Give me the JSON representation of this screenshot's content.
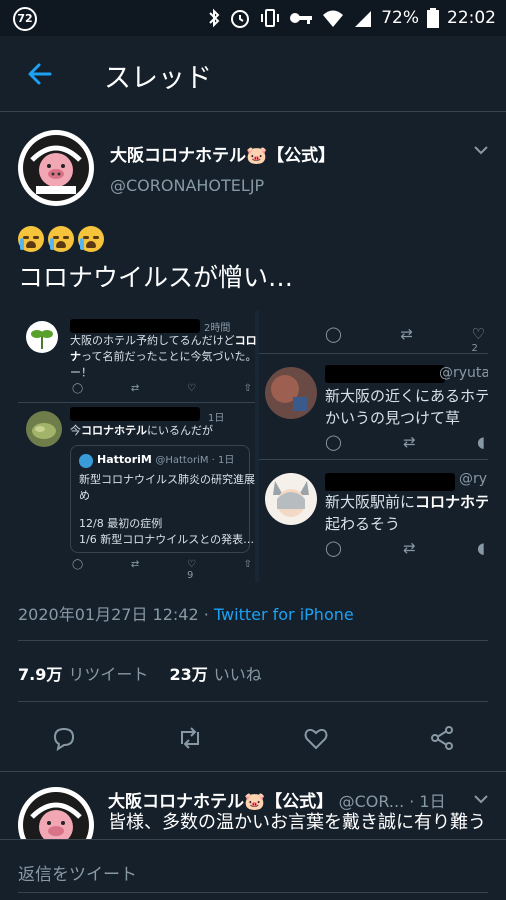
{
  "status_bar": {
    "notification_count": "72",
    "battery": "72%",
    "time": "22:02"
  },
  "header": {
    "title": "スレッド"
  },
  "main_tweet": {
    "name": "大阪コロナホテル🐷【公式】",
    "handle": "@CORONAHOTELJP",
    "text": "コロナウイルスが憎い…",
    "timestamp": "2020年01月27日 12:42 · ",
    "source": "Twitter for iPhone",
    "retweets_count": "7.9万",
    "retweets_label": "リツイート",
    "likes_count": "23万",
    "likes_label": "いいね"
  },
  "screenshot": {
    "tweet1": {
      "time": "2時間",
      "line1": "大阪のホテル予約してるんだけど",
      "line1_bold": "コロ",
      "line2_bold": "ナ",
      "line2": "って名前だったことに今気づいた。",
      "line3": "ー！"
    },
    "tweet2": {
      "time": "1日",
      "text_pre": "今",
      "text_bold": "コロナホテル",
      "text_post": "にいるんだが"
    },
    "quote": {
      "name": "HattoriM",
      "handle": "@HattoriM · 1日",
      "line1": "新型コロナウイルス肺炎の研究進展",
      "line2": "め",
      "line3": "12/8 最初の症例",
      "line4": "1/6 新型コロナウイルスとの発表…"
    },
    "like_count_quote": "9",
    "right_like_count": "2",
    "right_tweet1": {
      "handle": "@ryutaro_",
      "line1": "新大阪の近くにあるホテ",
      "line2": "かいうの見つけて草"
    },
    "right_tweet2": {
      "handle": "@ry",
      "line1_pre": "新大阪駅前に",
      "line1_bold": "コロナホテ",
      "line2": "起わるそう"
    }
  },
  "reply_tweet": {
    "name": "大阪コロナホテル🐷【公式】",
    "handle": "@COR... · 1日",
    "text": "皆様、多数の温かいお言葉を戴き誠に有り難う"
  },
  "reply_bar": {
    "placeholder": "返信をツイート"
  },
  "colors": {
    "background": "#15202b",
    "accent": "#1da1f2",
    "muted": "#8899a6",
    "border": "#38444d"
  }
}
